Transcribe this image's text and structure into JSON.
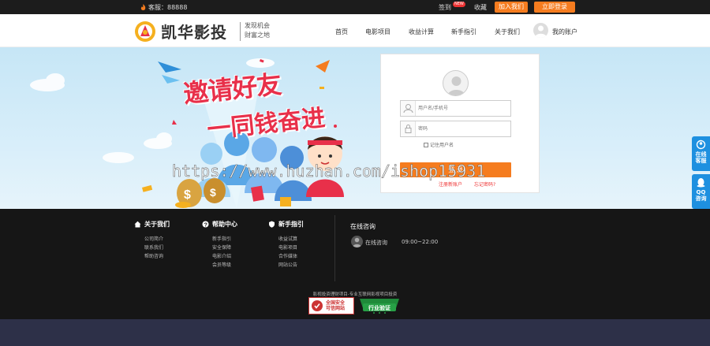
{
  "topbar": {
    "hotline": "客服：88888",
    "signin": "签到",
    "signin_badge": "NEW",
    "favorite": "收藏",
    "join_button": "加入我们",
    "register_button": "立即登录"
  },
  "header": {
    "logo_text": "凯华影投",
    "slogan_line1": "发现机会",
    "slogan_line2": "财富之地",
    "nav": [
      "首页",
      "电影项目",
      "收益计算",
      "新手指引",
      "关于我们"
    ],
    "account": "我的账户",
    "colors": {
      "accent": "#f57c1f",
      "brand_red": "#e8304a"
    }
  },
  "banner": {
    "title_line1": "邀请好友",
    "title_line2": "一同钱奋进"
  },
  "login": {
    "user_placeholder": "用户名/手机号",
    "password_placeholder": "密码",
    "remember_label": "记住用户名",
    "login_button": "登 录",
    "register_link": "注册新账户",
    "forgot_link": "忘记密码?"
  },
  "float": {
    "service_line1": "在线",
    "service_line2": "客服",
    "qq_line1": "QQ",
    "qq_line2": "咨询"
  },
  "watermark": "https://www.huzhan.com/ishop15931",
  "footer": {
    "about": {
      "title": "关于我们",
      "items": [
        "公司简介",
        "联系我们",
        "帮助咨询"
      ]
    },
    "help": {
      "title": "帮助中心",
      "items": [
        "新手指引",
        "安全保障",
        "电影介绍",
        "会员等级"
      ]
    },
    "guide": {
      "title": "新手指引",
      "items": [
        "收益试算",
        "电影项目",
        "合作媒体",
        "网站公告"
      ]
    },
    "online_title": "在线咨询",
    "online_label": "在线咨询",
    "online_hours": "09:00~22:00",
    "copyright": "影视投资理财项目-专业互联网影视项目投资",
    "safe_badge_line1": "全国安全",
    "safe_badge_line2": "可信网站",
    "verify_badge": "行业验证"
  }
}
